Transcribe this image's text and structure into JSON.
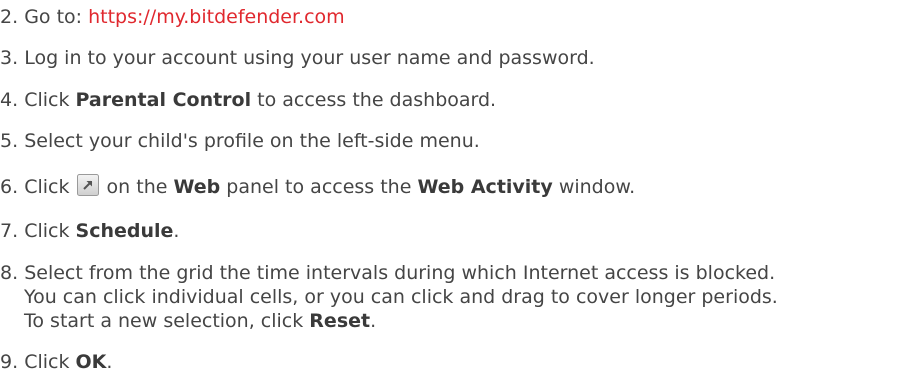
{
  "steps": [
    {
      "num": "2.",
      "text": "Go to: ",
      "link": "https://my.bitdefender.com"
    },
    {
      "num": "3.",
      "text": "Log in to your account using your user name and password."
    },
    {
      "num": "4.",
      "pre": "Click ",
      "bold": "Parental Control",
      "post": " to access the dashboard."
    },
    {
      "num": "5.",
      "text": "Select your child's profile on the left-side menu."
    },
    {
      "num": "6.",
      "pre": "Click ",
      "icon": "expand-window-icon",
      "mid1": " on the ",
      "bold1": "Web",
      "mid2": " panel to access the ",
      "bold2": "Web Activity",
      "post": " window."
    },
    {
      "num": "7.",
      "pre": "Click ",
      "bold": "Schedule",
      "post": "."
    },
    {
      "num": "8.",
      "line1": "Select from the grid the time intervals during which Internet access is blocked.",
      "line2": "You can click individual cells, or you can click and drag to cover longer periods.",
      "line3_pre": "To start a new selection, click ",
      "line3_bold": "Reset",
      "line3_post": "."
    },
    {
      "num": "9.",
      "pre": "Click ",
      "bold": "OK",
      "post": "."
    }
  ]
}
